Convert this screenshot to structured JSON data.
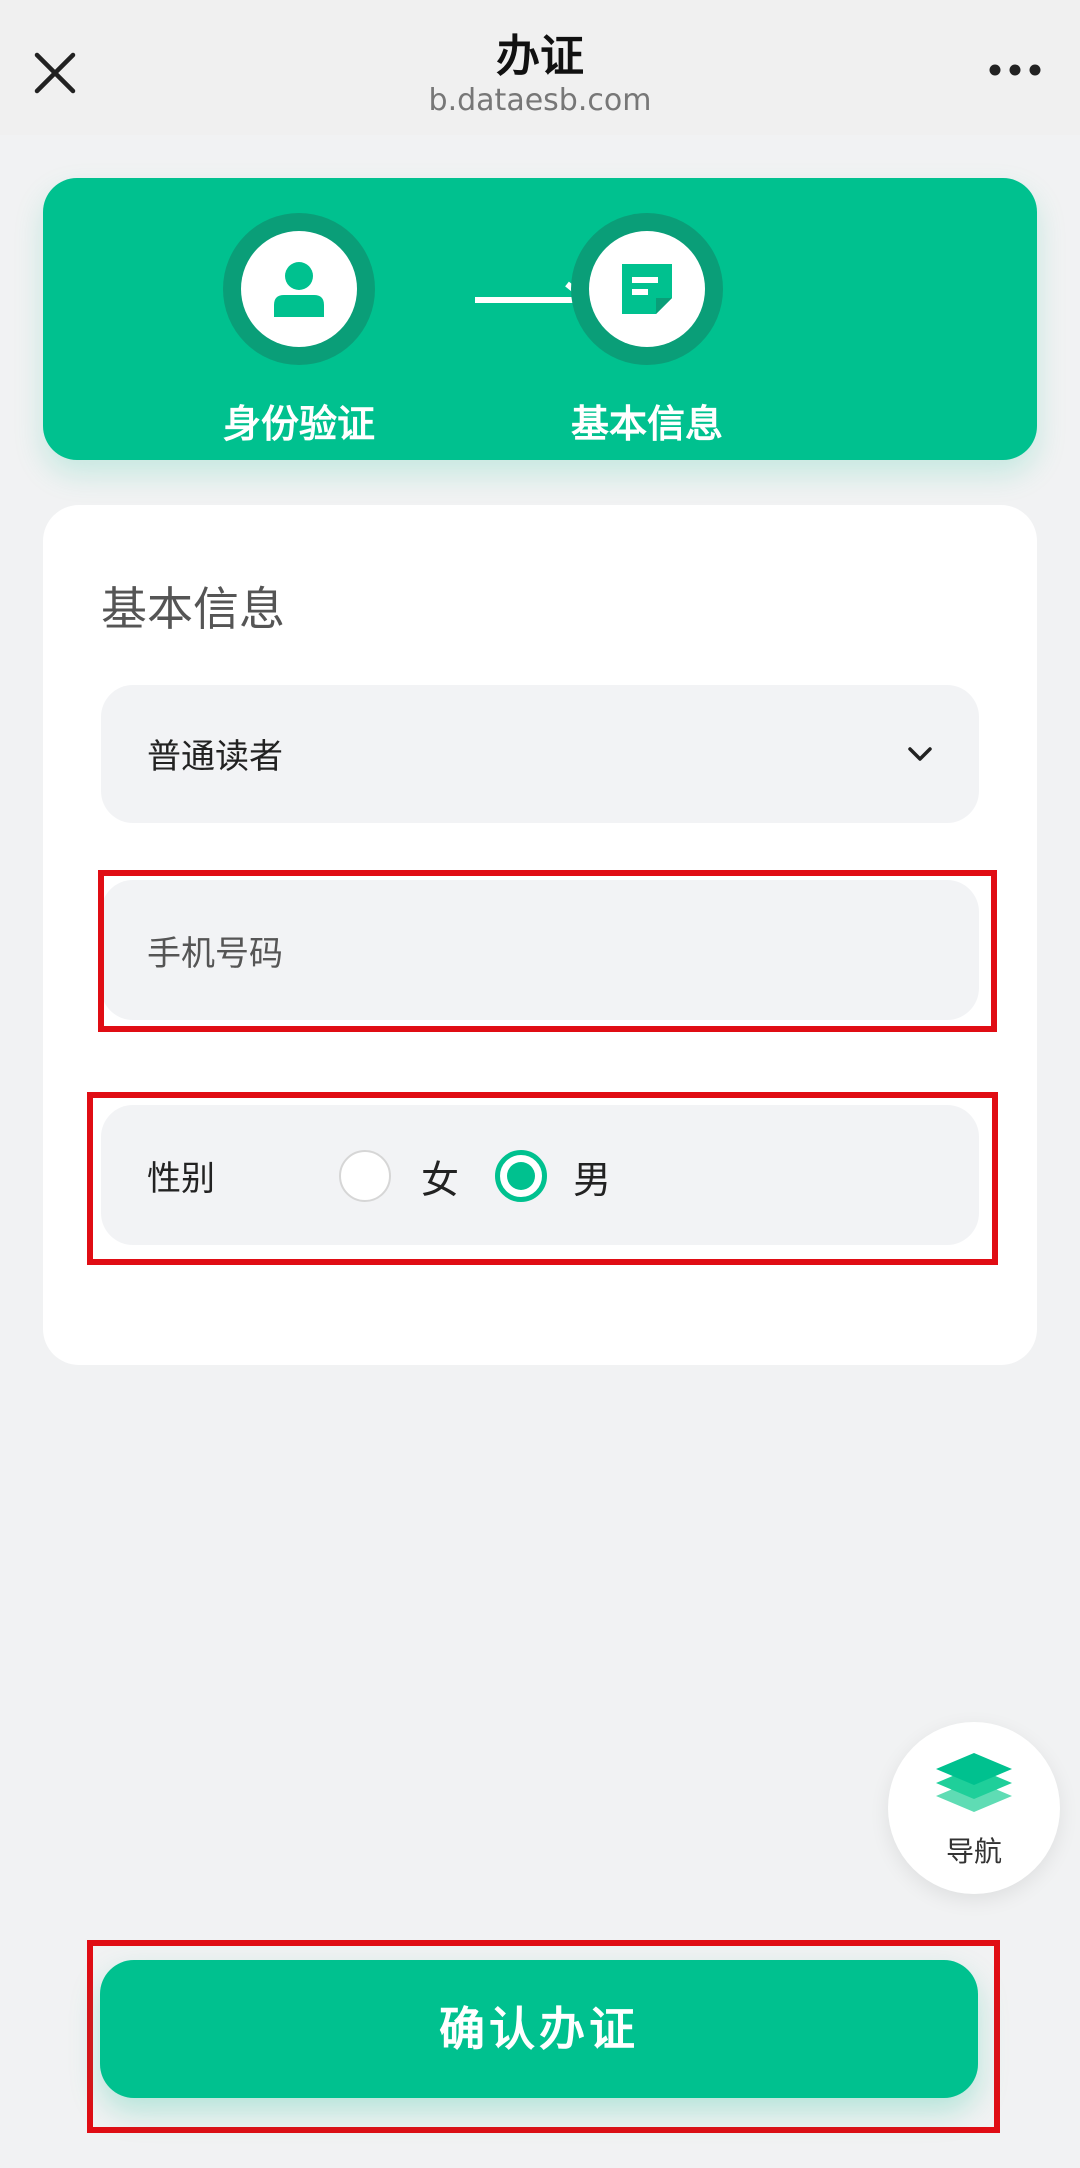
{
  "topbar": {
    "title": "办证",
    "url": "b.dataesb.com",
    "close_icon": "close-icon",
    "more_icon": "more-icon"
  },
  "steps": [
    {
      "label": "身份验证",
      "icon": "person-icon"
    },
    {
      "label": "基本信息",
      "icon": "document-icon"
    }
  ],
  "form": {
    "section_title": "基本信息",
    "reader_type": {
      "value": "普通读者",
      "icon": "chevron-down-icon"
    },
    "phone": {
      "label": "手机号码",
      "value": ""
    },
    "gender": {
      "label": "性别",
      "options": [
        {
          "label": "女",
          "selected": false
        },
        {
          "label": "男",
          "selected": true
        }
      ]
    }
  },
  "fab": {
    "label": "导航",
    "icon": "layers-icon"
  },
  "confirm_button": {
    "label": "确认办证"
  },
  "colors": {
    "accent": "#00c18f",
    "accent_dark": "#0a9e78",
    "highlight": "#e00d14",
    "background": "#f1f2f3"
  }
}
